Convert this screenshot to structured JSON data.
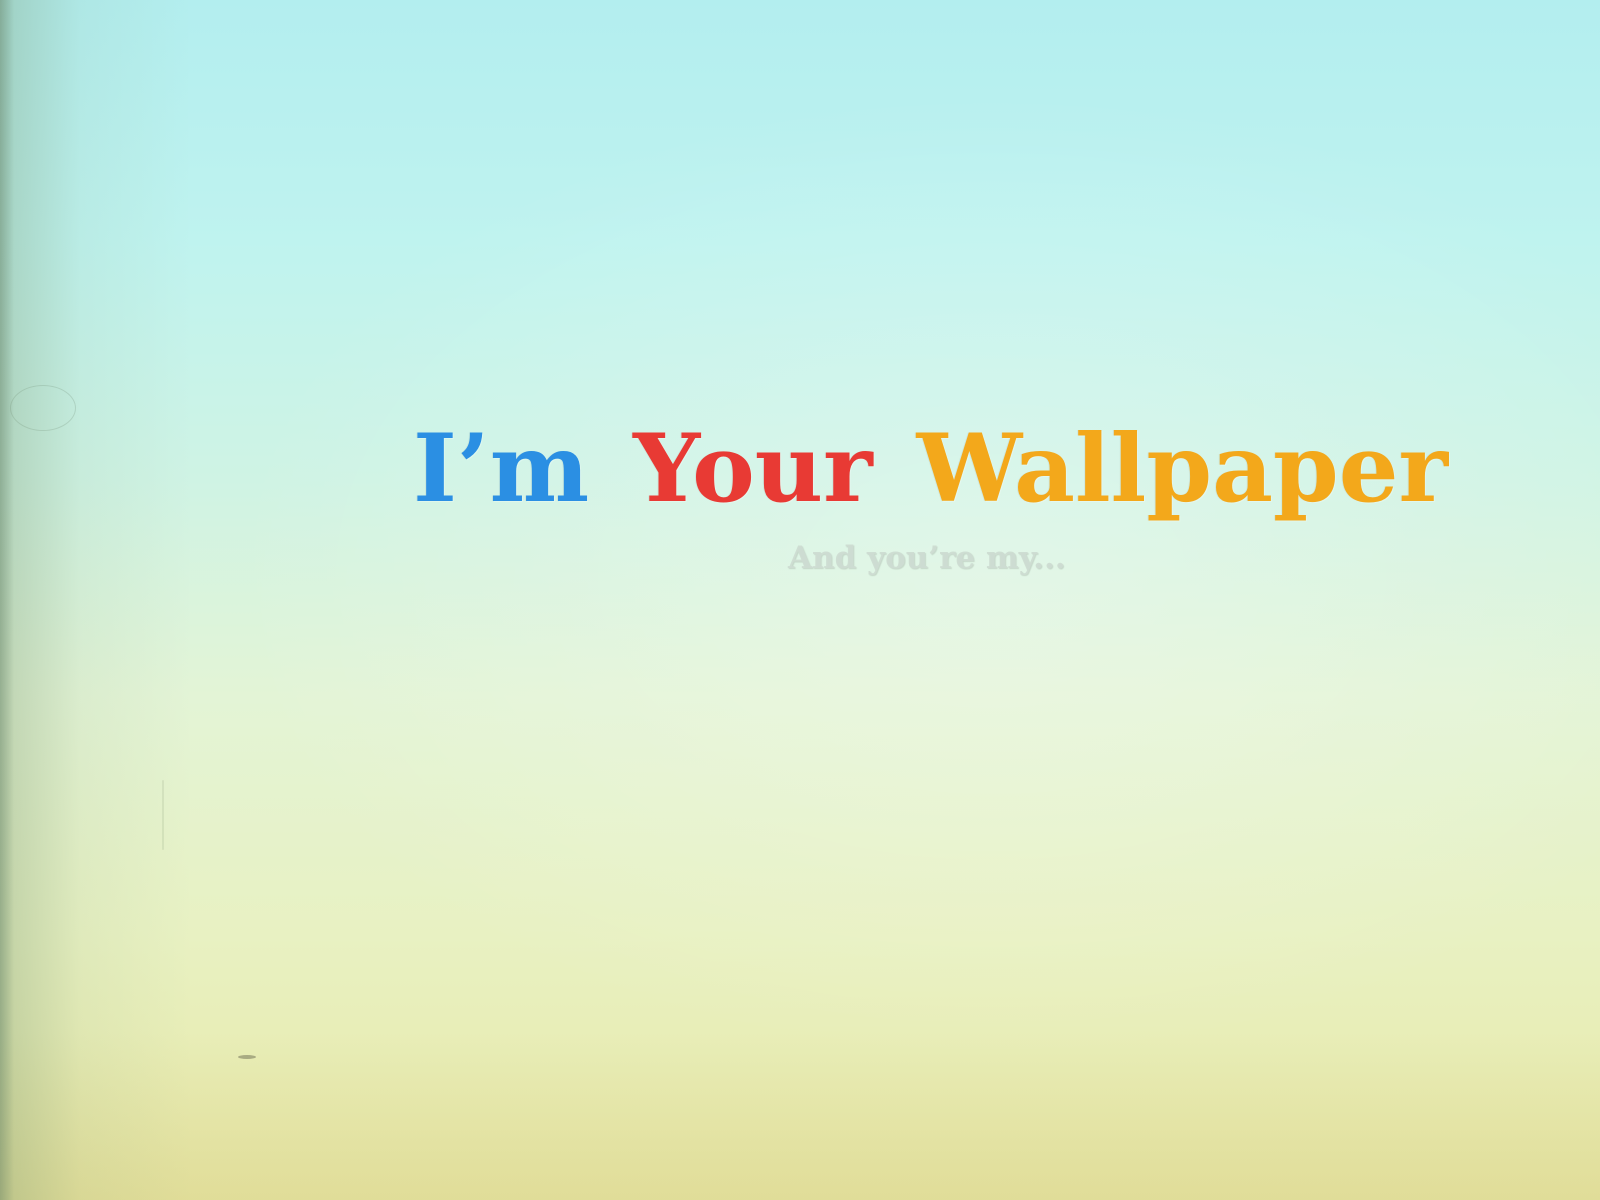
{
  "wallpaper": {
    "title_words": [
      "I’m",
      "Your",
      "Wallpaper"
    ],
    "subtitle": "And you’re my...",
    "colors": {
      "word_1": "#2b8fe3",
      "word_2": "#e83a34",
      "word_3": "#f3a81b",
      "background_top": "#b3eeef",
      "background_bottom": "#e8e8a6"
    }
  }
}
